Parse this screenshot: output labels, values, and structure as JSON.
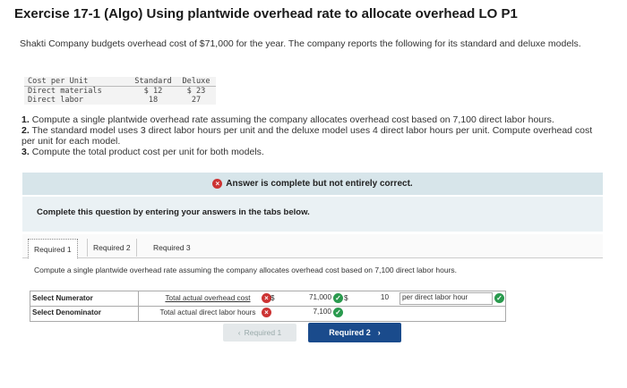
{
  "title": "Exercise 17-1 (Algo) Using plantwide overhead rate to allocate overhead LO P1",
  "intro": "Shakti Company budgets overhead cost of $71,000 for the year. The company reports the following for its standard and deluxe models.",
  "cost_table": {
    "headers": [
      "Cost per Unit",
      "Standard",
      "Deluxe"
    ],
    "rows": [
      [
        "Direct materials",
        "$ 12",
        "$ 23"
      ],
      [
        "Direct labor",
        "18",
        "27"
      ]
    ]
  },
  "questions": [
    {
      "num": "1.",
      "text": "Compute a single plantwide overhead rate assuming the company allocates overhead cost based on 7,100 direct labor hours."
    },
    {
      "num": "2.",
      "text": "The standard model uses 3 direct labor hours per unit and the deluxe model uses 4 direct labor hours per unit. Compute overhead cost per unit for each model."
    },
    {
      "num": "3.",
      "text": "Compute the total product cost per unit for both models."
    }
  ],
  "banner": "Answer is complete but not entirely correct.",
  "instruction": "Complete this question by entering your answers in the tabs below.",
  "tabs": [
    "Required 1",
    "Required 2",
    "Required 3"
  ],
  "prompt": "Compute a single plantwide overhead rate assuming the company allocates overhead cost based on 7,100 direct labor hours.",
  "calc": {
    "numerator_label": "Select Numerator",
    "denominator_label": "Select Denominator",
    "numerator_text": "Total actual overhead cost",
    "denominator_text": "Total actual direct labor hours",
    "dollar": "$",
    "numerator_value": "71,000",
    "denominator_value": "7,100",
    "result": "10",
    "unit": "per direct labor hour"
  },
  "buttons": {
    "prev": "Required 1",
    "next": "Required 2"
  },
  "icons": {
    "wrong": "×",
    "correct": "✓",
    "prev": "‹",
    "next": "›"
  },
  "colors": {
    "correct": "#2a9a4e",
    "incorrect": "#cc3333",
    "primary": "#1a4b8c"
  }
}
